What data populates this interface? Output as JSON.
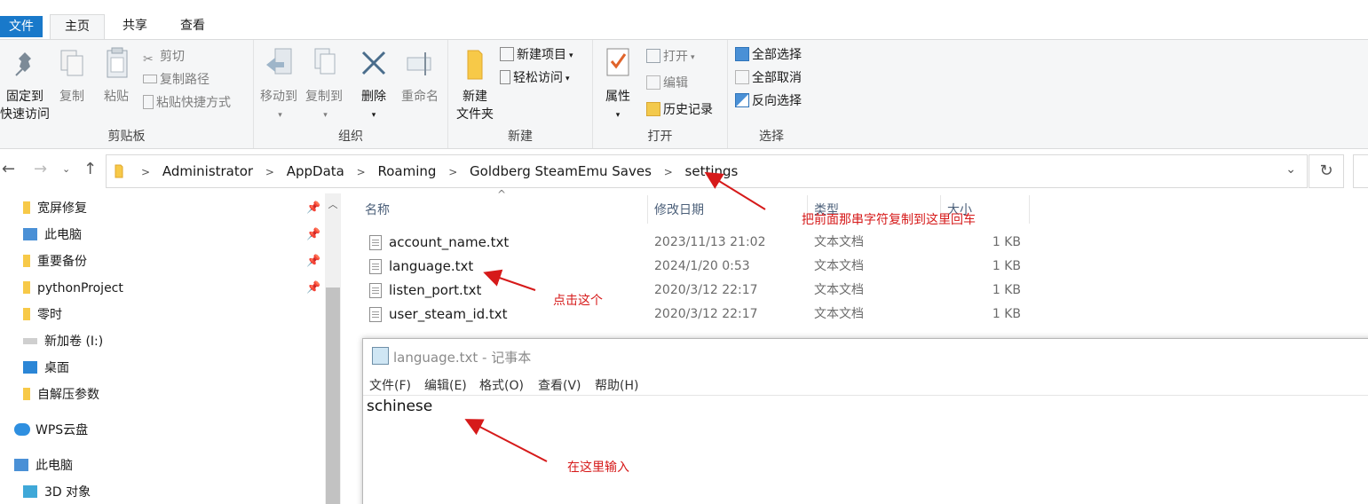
{
  "ribbon_tabs": {
    "file": "文件",
    "home": "主页",
    "share": "共享",
    "view": "查看"
  },
  "clipboard": {
    "pin_line1": "固定到",
    "pin_line2": "快速访问",
    "copy": "复制",
    "paste": "粘贴",
    "cut": "剪切",
    "copy_path": "复制路径",
    "paste_shortcut": "粘贴快捷方式",
    "group_label": "剪贴板"
  },
  "organize": {
    "move_to": "移动到",
    "copy_to": "复制到",
    "delete": "删除",
    "rename": "重命名",
    "group_label": "组织"
  },
  "new_group": {
    "new_item": "新建项目",
    "easy_access": "轻松访问",
    "new_folder_line1": "新建",
    "new_folder_line2": "文件夹",
    "group_label": "新建"
  },
  "open_group": {
    "properties": "属性",
    "open": "打开",
    "edit": "编辑",
    "history": "历史记录",
    "group_label": "打开"
  },
  "select_group": {
    "select_all": "全部选择",
    "select_none": "全部取消",
    "invert": "反向选择",
    "group_label": "选择"
  },
  "breadcrumb": [
    "Administrator",
    "AppData",
    "Roaming",
    "Goldberg SteamEmu Saves",
    "settings"
  ],
  "nav_items": [
    {
      "label": "宽屏修复",
      "pinned": true
    },
    {
      "label": "此电脑",
      "pinned": true
    },
    {
      "label": "重要备份",
      "pinned": true
    },
    {
      "label": "pythonProject",
      "pinned": true
    },
    {
      "label": "零时",
      "pinned": false
    },
    {
      "label": "新加卷 (I:)",
      "pinned": false
    },
    {
      "label": "桌面",
      "pinned": false
    },
    {
      "label": "自解压参数",
      "pinned": false
    },
    {
      "label": "WPS云盘",
      "pinned": false
    },
    {
      "label": "此电脑",
      "pinned": false
    },
    {
      "label": "3D 对象",
      "pinned": false
    }
  ],
  "columns": {
    "name": "名称",
    "modified": "修改日期",
    "type": "类型",
    "size": "大小"
  },
  "files": [
    {
      "name": "account_name.txt",
      "modified": "2023/11/13 21:02",
      "type": "文本文档",
      "size": "1 KB"
    },
    {
      "name": "language.txt",
      "modified": "2024/1/20 0:53",
      "type": "文本文档",
      "size": "1 KB"
    },
    {
      "name": "listen_port.txt",
      "modified": "2020/3/12 22:17",
      "type": "文本文档",
      "size": "1 KB"
    },
    {
      "name": "user_steam_id.txt",
      "modified": "2020/3/12 22:17",
      "type": "文本文档",
      "size": "1 KB"
    }
  ],
  "notepad": {
    "title": "language.txt - 记事本",
    "menu": [
      "文件(F)",
      "编辑(E)",
      "格式(O)",
      "查看(V)",
      "帮助(H)"
    ],
    "content": "schinese"
  },
  "annotations": {
    "address_note": "把前面那串字符复制到这里回车",
    "click_note": "点击这个",
    "input_note": "在这里输入"
  },
  "colors": {
    "accent": "#1979ca",
    "annotation": "#d61a1a",
    "ribbon_bg": "#f5f6f7"
  }
}
